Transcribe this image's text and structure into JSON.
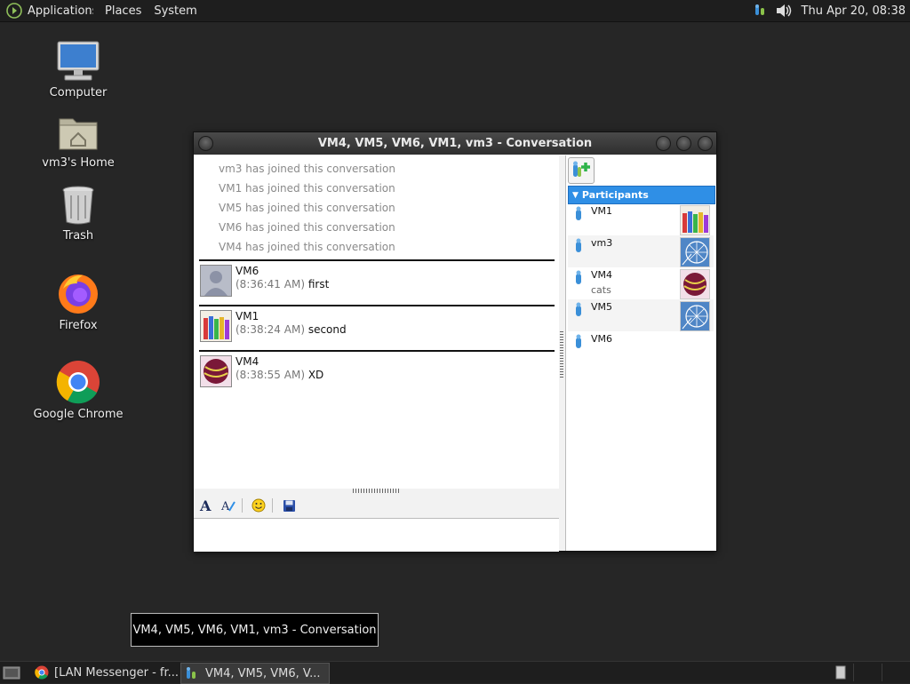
{
  "top_panel": {
    "menus": [
      "Applications",
      "Places",
      "System"
    ],
    "clock": "Thu Apr 20, 08:38"
  },
  "desktop": {
    "icons": [
      {
        "label": "Computer",
        "icon": "computer-icon"
      },
      {
        "label": "vm3's Home",
        "icon": "home-folder-icon"
      },
      {
        "label": "Trash",
        "icon": "trash-icon"
      },
      {
        "label": "Firefox",
        "icon": "firefox-icon"
      },
      {
        "label": "Google Chrome",
        "icon": "chrome-icon"
      }
    ]
  },
  "window": {
    "title": "VM4, VM5, VM6, VM1, vm3 - Conversation",
    "system_messages": [
      "vm3 has joined this conversation",
      "VM1 has joined this conversation",
      "VM5 has joined this conversation",
      "VM6 has joined this conversation",
      "VM4 has joined this conversation"
    ],
    "messages": [
      {
        "sender": "VM6",
        "time": "(8:36:41 AM)",
        "text": "first"
      },
      {
        "sender": "VM1",
        "time": "(8:38:24 AM)",
        "text": "second"
      },
      {
        "sender": "VM4",
        "time": "(8:38:55 AM)",
        "text": "XD"
      }
    ],
    "toolbar": [
      "font-icon",
      "font-color-icon",
      "smiley-icon",
      "save-icon"
    ],
    "input_value": "",
    "participants_label": "Participants",
    "participants": [
      {
        "name": "VM1",
        "status": "",
        "avatar": "crayons"
      },
      {
        "name": "vm3",
        "status": "",
        "avatar": "ferris-wheel"
      },
      {
        "name": "VM4",
        "status": "cats",
        "avatar": "ball"
      },
      {
        "name": "VM5",
        "status": "",
        "avatar": "ferris-wheel"
      },
      {
        "name": "VM6",
        "status": "",
        "avatar": ""
      }
    ]
  },
  "tooltip": "VM4, VM5, VM6, VM1, vm3 - Conversation",
  "taskbar": {
    "tasks": [
      {
        "label": "[LAN Messenger - fr...",
        "icon": "chrome-icon"
      },
      {
        "label": "VM4, VM5, VM6, V...",
        "icon": "messenger-icon"
      }
    ]
  },
  "colors": {
    "accent": "#2f8fe6",
    "desktop_bg": "#262626"
  }
}
